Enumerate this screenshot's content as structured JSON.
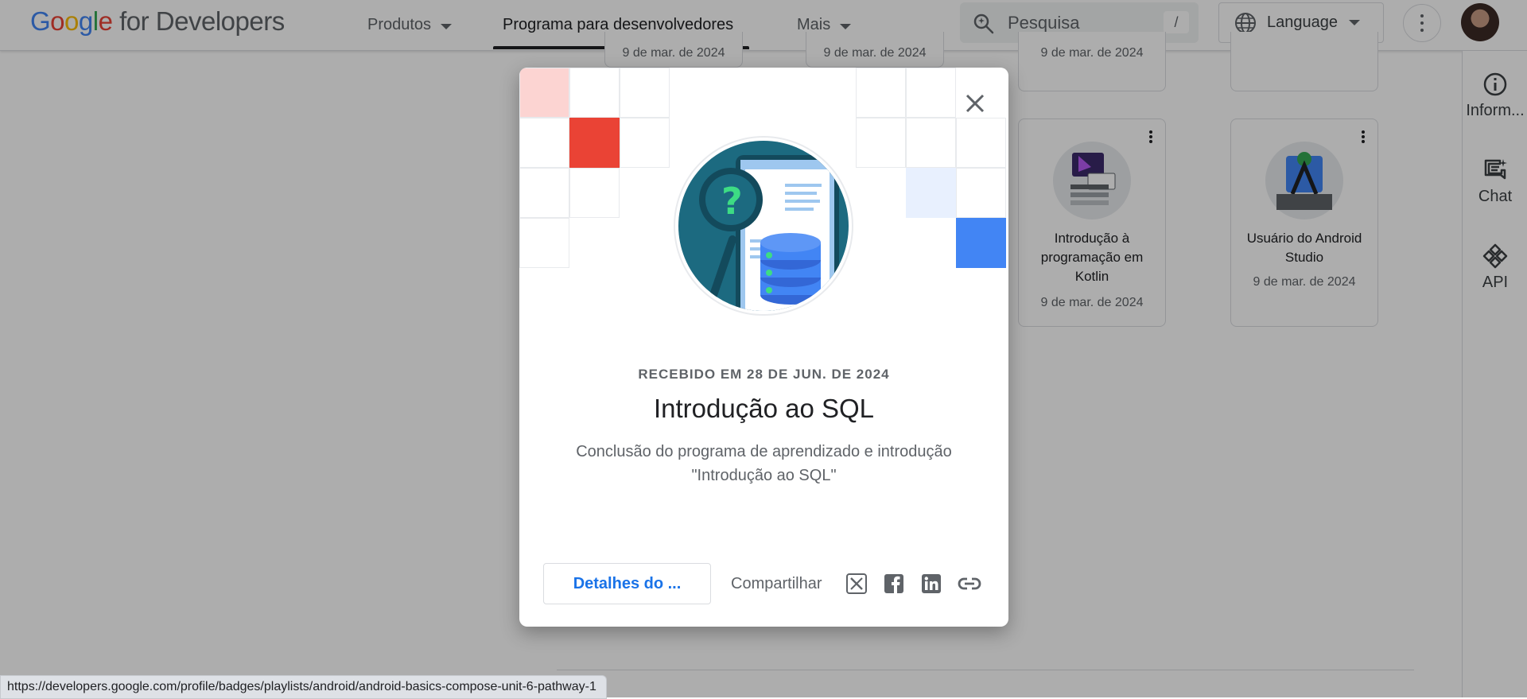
{
  "header": {
    "logo_google": "Google",
    "logo_suffix": "for Developers",
    "nav": [
      {
        "label": "Produtos"
      },
      {
        "label": "Programa para desenvolvedores"
      },
      {
        "label": "Mais"
      }
    ],
    "search_placeholder": "Pesquisa",
    "search_shortcut": "/",
    "language_label": "Language"
  },
  "background": {
    "top_cards": [
      {
        "date": "9 de mar. de 2024"
      },
      {
        "date": "9 de mar. de 2024"
      },
      {
        "date": "9 de mar. de 2024"
      }
    ],
    "cards": [
      {
        "title": "Introdução à programação em Kotlin",
        "date": "9 de mar. de 2024",
        "icon": "kotlin-badge-icon"
      },
      {
        "title": "Usuário do Android Studio",
        "date": "9 de mar. de 2024",
        "icon": "android-studio-badge-icon"
      }
    ],
    "right_rail": [
      {
        "label": "Inform...",
        "icon": "info-icon"
      },
      {
        "label": "Chat",
        "icon": "chat-icon"
      },
      {
        "label": "API",
        "icon": "api-icon"
      }
    ]
  },
  "modal": {
    "received": "RECEBIDO EM 28 DE JUN. DE 2024",
    "title": "Introdução ao SQL",
    "description": "Conclusão do programa de aprendizado e introdução \"Introdução ao SQL\"",
    "details_button": "Detalhes do ...",
    "share_label": "Compartilhar",
    "share_icons": [
      "x-icon",
      "facebook-icon",
      "linkedin-icon",
      "link-icon"
    ],
    "colors": {
      "accent_red": "#ea4335",
      "accent_blue": "#4285f4",
      "light_red": "#fcd4d2",
      "light_blue": "#e8f0fe"
    }
  },
  "status_bar": {
    "url": "https://developers.google.com/profile/badges/playlists/android/android-basics-compose-unit-6-pathway-1"
  }
}
